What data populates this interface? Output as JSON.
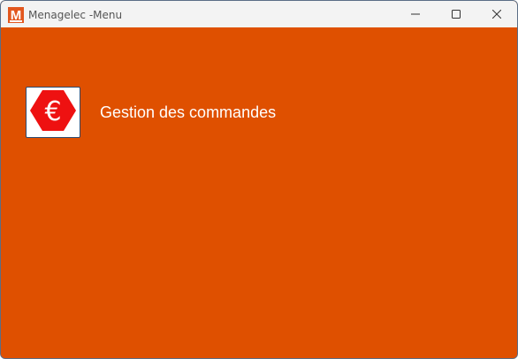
{
  "window": {
    "title": "Menagelec -Menu",
    "app_icon": "menagelec-m-logo",
    "controls": {
      "minimize_icon": "minimize-icon",
      "maximize_icon": "maximize-icon",
      "close_icon": "close-icon"
    }
  },
  "menu": {
    "items": [
      {
        "label": "Gestion des commandes",
        "icon": "euro-octagon-icon",
        "icon_glyph": "€"
      }
    ]
  },
  "colors": {
    "background": "#df5000",
    "icon_red": "#ee1111",
    "titlebar": "#f3f3f3",
    "logo_orange": "#e2571e"
  }
}
